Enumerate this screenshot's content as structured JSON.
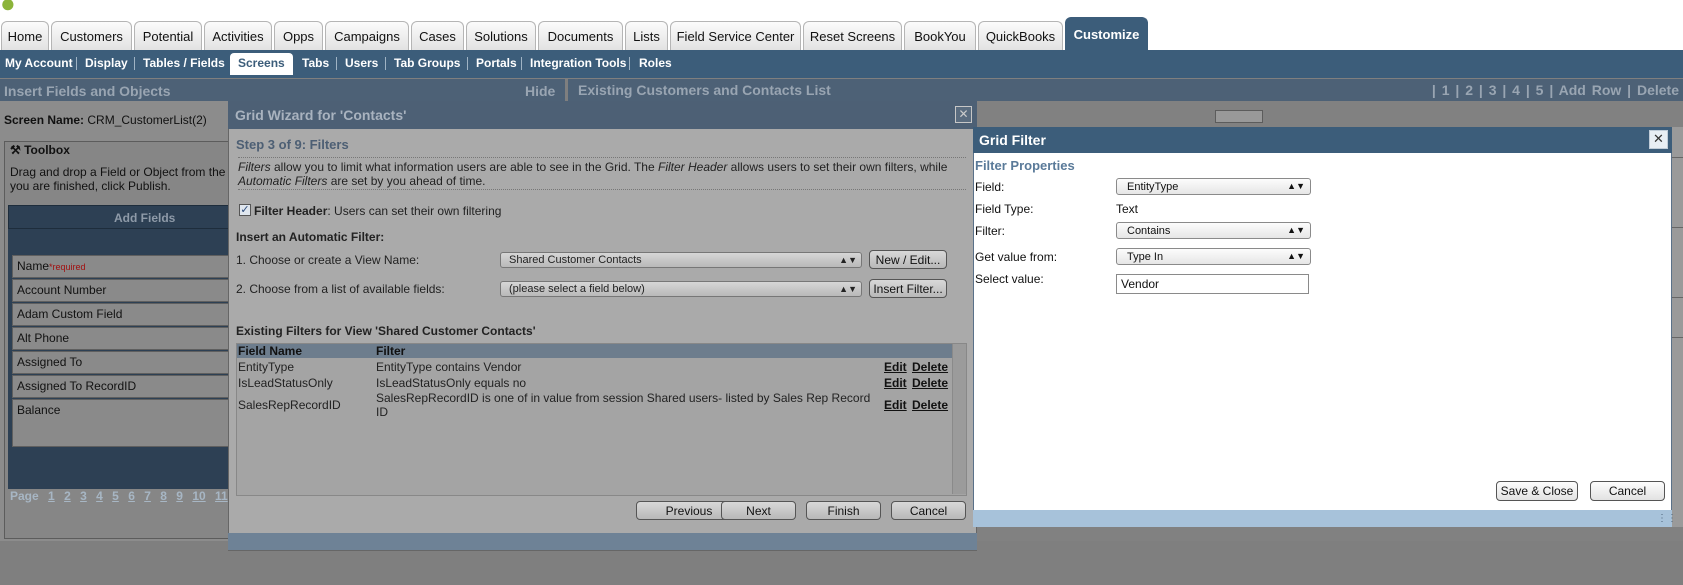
{
  "header": {
    "tabs": [
      {
        "label": "Home",
        "active": false
      },
      {
        "label": "Customers",
        "active": false
      },
      {
        "label": "Potential",
        "active": false
      },
      {
        "label": "Activities",
        "active": false
      },
      {
        "label": "Opps",
        "active": false
      },
      {
        "label": "Campaigns",
        "active": false
      },
      {
        "label": "Cases",
        "active": false
      },
      {
        "label": "Solutions",
        "active": false
      },
      {
        "label": "Documents",
        "active": false
      },
      {
        "label": "Lists",
        "active": false
      },
      {
        "label": "Field Service Center",
        "active": false
      },
      {
        "label": "Reset Screens",
        "active": false
      },
      {
        "label": "BookYou",
        "active": false
      },
      {
        "label": "QuickBooks",
        "active": false
      },
      {
        "label": "Customize",
        "active": true
      }
    ],
    "brand_color": "#3c5d7a"
  },
  "subnav": {
    "items": [
      {
        "label": "My Account"
      },
      {
        "label": "Display"
      },
      {
        "label": "Tables / Fields"
      },
      {
        "label": "Screens",
        "active": true
      },
      {
        "label": "Tabs"
      },
      {
        "label": "Users"
      },
      {
        "label": "Tab Groups"
      },
      {
        "label": "Portals"
      },
      {
        "label": "Integration Tools"
      },
      {
        "label": "Roles"
      }
    ]
  },
  "left_panel": {
    "title": "Insert Fields and Objects",
    "hide_label": "Hide",
    "screen_name_label": "Screen Name:",
    "screen_name_value": "CRM_CustomerList(2)",
    "toolbox_title": "Toolbox",
    "toolbox_desc": "Drag and drop a Field or Object from the",
    "toolbox_desc2": "you are finished, click Publish.",
    "add_fields_title": "Add Fields",
    "fields": [
      {
        "label": "Name",
        "required": "*required"
      },
      {
        "label": "Account Number"
      },
      {
        "label": "Adam Custom Field"
      },
      {
        "label": "Alt Phone"
      },
      {
        "label": "Assigned To"
      },
      {
        "label": "Assigned To RecordID"
      },
      {
        "label": "Balance"
      }
    ],
    "pager_label": "Page",
    "pages": [
      "1",
      "2",
      "3",
      "4",
      "5",
      "6",
      "7",
      "8",
      "9",
      "10",
      "11"
    ]
  },
  "right_panel": {
    "title": "Existing Customers and Contacts List",
    "links": "| 1  | 2  | 3  | 4  | 5  | Add Row  | Delete"
  },
  "wizard": {
    "title": "Grid Wizard for 'Contacts'",
    "step": "Step 3 of 9: Filters",
    "desc": {
      "p1": "Filters",
      "p2": " allow you to limit what information users are able to see in the Grid. The ",
      "p3": "Filter Header",
      "p4": " allows users to set their own filters, while",
      "p5": "Automatic Filters",
      "p6": " are set by you ahead of time."
    },
    "filter_header_checked": true,
    "filter_header_bold": "Filter Header",
    "filter_header_rest": ": Users can set their own filtering",
    "auto_filter_label": "Insert an Automatic Filter:",
    "choose_view_label": "1. Choose or create a View Name:",
    "view_name_value": "Shared Customer Contacts",
    "new_edit_label": "New / Edit...",
    "choose_field_label": "2. Choose from a list of available fields:",
    "field_value": "(please select a field below)",
    "insert_filter_label": "Insert Filter...",
    "existing_label": "Existing Filters for View 'Shared Customer Contacts'",
    "table": {
      "headers": [
        "Field Name",
        "Filter"
      ],
      "rows": [
        {
          "field": "EntityType",
          "filter": "EntityType contains Vendor"
        },
        {
          "field": "IsLeadStatusOnly",
          "filter": "IsLeadStatusOnly equals no"
        },
        {
          "field": "SalesRepRecordID",
          "filter": "SalesRepRecordID is one of in value from session Shared users- listed by Sales Rep Record",
          "filter2": "ID"
        }
      ],
      "edit_label": "Edit",
      "delete_label": "Delete"
    },
    "buttons": {
      "previous": "Previous",
      "next": "Next",
      "finish": "Finish",
      "cancel": "Cancel"
    }
  },
  "grid_filter": {
    "title": "Grid Filter",
    "section": "Filter Properties",
    "field_label": "Field:",
    "field_value": "EntityType",
    "field_type_label": "Field Type:",
    "field_type_value": "Text",
    "filter_label": "Filter:",
    "filter_value": "Contains",
    "get_value_label": "Get value from:",
    "get_value_value": "Type In",
    "select_value_label": "Select value:",
    "select_value_value": "Vendor",
    "save_close_label": "Save & Close",
    "cancel_label": "Cancel"
  },
  "icons": {
    "close": "close-icon",
    "toolbox": "tools-icon",
    "dropdown": "dropdown-arrow-icon"
  }
}
